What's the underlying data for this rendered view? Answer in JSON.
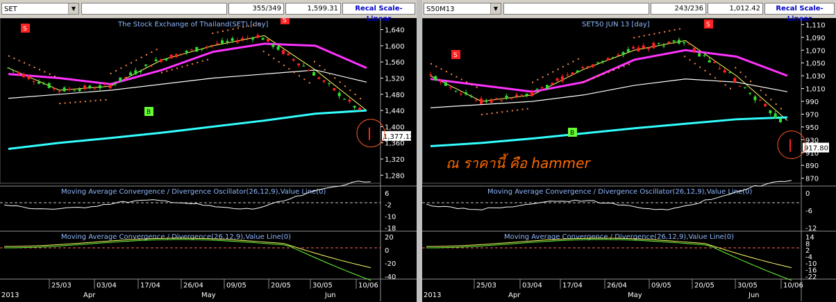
{
  "left": {
    "symbol": "SET",
    "ratio": "355/349",
    "last": "1,599.31",
    "recal": "Recal Scale-Linear",
    "title": "The Stock Exchange of Thailand(SET) [day]",
    "price_label": "1,377.12",
    "macd_title": "Moving Average Convergence / Divergence Oscillator(26,12,9),Value Line(0)",
    "macd2_title": "Moving Average Convergence / Divergence(26,12,9),Value Line(0)",
    "price_ticks": [
      "1,640",
      "1,600",
      "1,560",
      "1,520",
      "1,480",
      "1,440",
      "1,400",
      "1,360",
      "1,320",
      "1,280"
    ],
    "osc_ticks": [
      "6",
      "-2",
      "-10",
      "-18"
    ],
    "macd_ticks": [
      "20",
      "0",
      "-20",
      "-40"
    ],
    "date_labels": [
      "25/03",
      "03/04",
      "17/04",
      "26/04",
      "09/05",
      "20/05",
      "30/05",
      "10/06"
    ],
    "month_labels": [
      "2013",
      "Apr",
      "May",
      "Jun"
    ],
    "signals": [
      "S",
      "B",
      "S"
    ]
  },
  "right": {
    "symbol": "S50M13",
    "ratio": "243/236",
    "last": "1,012.42",
    "recal": "Recal Scale-Linear",
    "title": "SET50 JUN 13  [day]",
    "price_label": "917.80",
    "annotation": "ณ ราคานี้ คือ hammer",
    "macd_title": "Moving Average Convergence / Divergence Oscillator(26,12,9),Value Line(0)",
    "macd2_title": "Moving Average Convergence / Divergence(26,12,9),Value Line(0)",
    "price_ticks": [
      "1,110",
      "1,090",
      "1,070",
      "1,050",
      "1,030",
      "1,010",
      "990",
      "970",
      "950",
      "930",
      "910",
      "890",
      "870"
    ],
    "osc_ticks": [
      "0",
      "-6",
      "-12"
    ],
    "macd_ticks": [
      "14",
      "8",
      "2",
      "-4",
      "-10",
      "-16",
      "-22"
    ],
    "date_labels": [
      "25/03",
      "03/04",
      "17/04",
      "26/04",
      "09/05",
      "20/05",
      "30/05",
      "10/06"
    ],
    "month_labels": [
      "2013",
      "Apr",
      "May",
      "Jun"
    ],
    "signals": [
      "S",
      "B",
      "S"
    ]
  },
  "chart_data": [
    {
      "type": "line",
      "title": "The Stock Exchange of Thailand(SET) [day]",
      "y_ticks": [
        1640,
        1600,
        1560,
        1520,
        1480,
        1440,
        1400,
        1360,
        1320,
        1280
      ],
      "ylim": [
        1260,
        1665
      ],
      "x": [
        "25/03",
        "03/04",
        "17/04",
        "26/04",
        "09/05",
        "20/05",
        "30/05",
        "10/06"
      ],
      "series": [
        {
          "name": "close",
          "values": [
            1545,
            1490,
            1500,
            1565,
            1600,
            1625,
            1540,
            1440
          ]
        },
        {
          "values": [
            1530,
            1520,
            1505,
            1540,
            1585,
            1605,
            1600,
            1545
          ]
        },
        {
          "values": [
            1470,
            1480,
            1490,
            1505,
            1520,
            1530,
            1540,
            1510
          ]
        },
        {
          "values": [
            1345,
            1360,
            1372,
            1385,
            1400,
            1415,
            1432,
            1440
          ]
        }
      ],
      "last_value": 1377.12
    },
    {
      "type": "line",
      "title": "SET50 JUN 13  [day]",
      "y_ticks": [
        1110,
        1090,
        1070,
        1050,
        1030,
        1010,
        990,
        970,
        950,
        930,
        910,
        890,
        870
      ],
      "ylim": [
        862,
        1118
      ],
      "x": [
        "25/03",
        "03/04",
        "17/04",
        "26/04",
        "09/05",
        "20/05",
        "30/05",
        "10/06"
      ],
      "series": [
        {
          "name": "close",
          "values": [
            1030,
            990,
            1000,
            1040,
            1070,
            1085,
            1030,
            960
          ]
        },
        {
          "values": [
            1025,
            1015,
            1005,
            1020,
            1055,
            1070,
            1060,
            1030
          ]
        },
        {
          "values": [
            980,
            985,
            990,
            1000,
            1015,
            1025,
            1020,
            1005
          ]
        },
        {
          "values": [
            920,
            925,
            932,
            940,
            948,
            955,
            962,
            965
          ]
        }
      ],
      "last_value": 917.8
    }
  ]
}
